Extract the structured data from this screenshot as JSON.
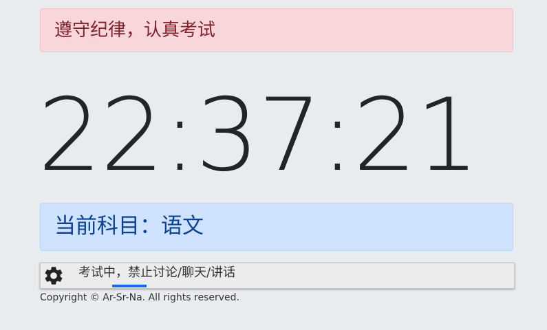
{
  "alert_top": {
    "text": "遵守纪律，认真考试"
  },
  "clock": {
    "time": "22:37:21"
  },
  "subject": {
    "text": "当前科目：语文"
  },
  "notice": {
    "text": "考试中，禁止讨论/聊天/讲话",
    "icon": "gear-icon"
  },
  "footer": {
    "text": "Copyright © Ar-Sr-Na. All rights reserved."
  },
  "colors": {
    "background": "#e9ecef",
    "danger_bg": "#f8d7da",
    "danger_text": "#842029",
    "primary_bg": "#cfe2ff",
    "primary_text": "#084298",
    "accent": "#0d6efd"
  }
}
